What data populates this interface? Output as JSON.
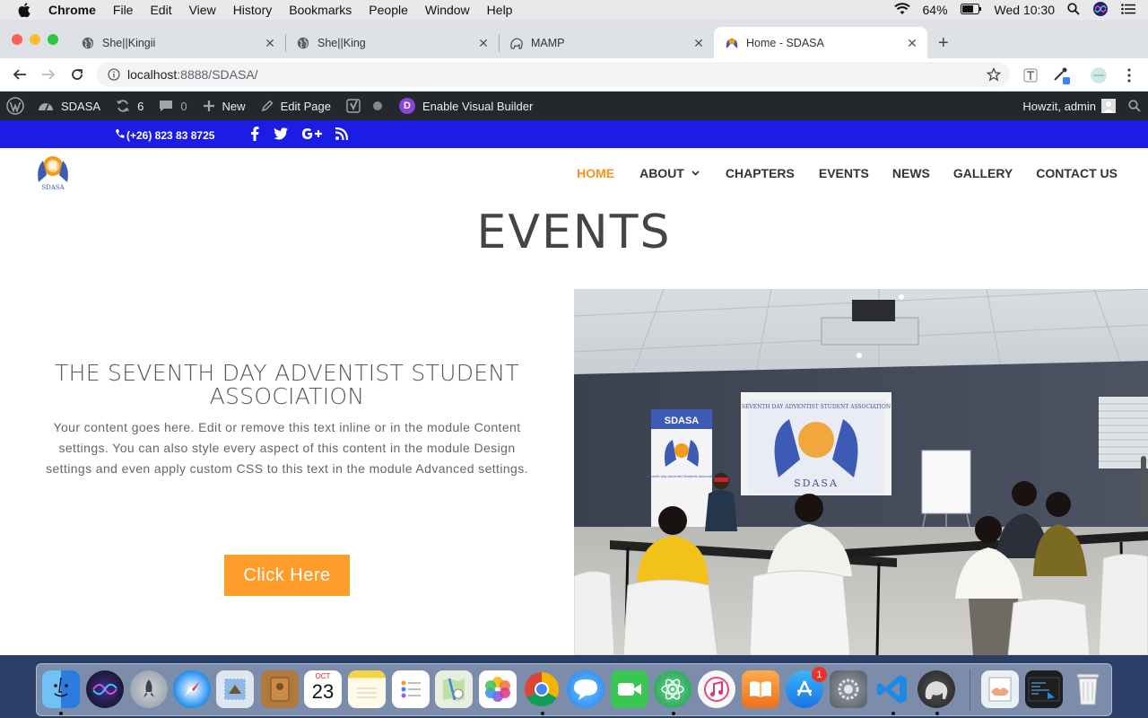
{
  "menubar": {
    "app": "Chrome",
    "items": [
      "File",
      "Edit",
      "View",
      "History",
      "Bookmarks",
      "People",
      "Window",
      "Help"
    ],
    "battery": "64%",
    "clock": "Wed 10:30"
  },
  "tabs": [
    {
      "title": "She||Kingii"
    },
    {
      "title": "She||King"
    },
    {
      "title": "MAMP"
    },
    {
      "title": "Home - SDASA",
      "active": true
    }
  ],
  "toolbar": {
    "url_host": "localhost",
    "url_path": ":8888/SDASA/"
  },
  "wpbar": {
    "site": "SDASA",
    "updates": "6",
    "comments": "0",
    "new": "New",
    "edit_page": "Edit Page",
    "visual_builder": "Enable Visual Builder",
    "visual_builder_icon": "D",
    "greeting": "Howzit, admin"
  },
  "topbar": {
    "phone": "(+26) 823 83 8725",
    "social": [
      "facebook-icon",
      "twitter-icon",
      "google-plus-icon",
      "rss-icon"
    ],
    "background": "#1b1de6"
  },
  "nav": {
    "items": [
      "HOME",
      "ABOUT",
      "CHAPTERS",
      "EVENTS",
      "NEWS",
      "GALLERY",
      "CONTACT US"
    ],
    "active_color": "#f7931e"
  },
  "content": {
    "heading": "EVENTS",
    "assoc_title": "THE SEVENTH DAY ADVENTIST STUDENT ASSOCIATION",
    "body": "Your content goes here. Edit or remove this text inline or in the module Content settings. You can also style every aspect of this content in the module Design settings and even apply custom CSS to this text in the module Advanced settings.",
    "button": "Click Here",
    "button_color": "#ff9c2a",
    "banner_title": "SDASA",
    "banner_sub": "Seventh-day Adventist Students Association",
    "screen_title": "SEVENTH DAY ADVENTIST STUDENT ASSOCIATION",
    "screen_logo": "SDASA"
  },
  "dock": {
    "calendar_month": "OCT",
    "calendar_day": "23",
    "appstore_badge": "1"
  }
}
